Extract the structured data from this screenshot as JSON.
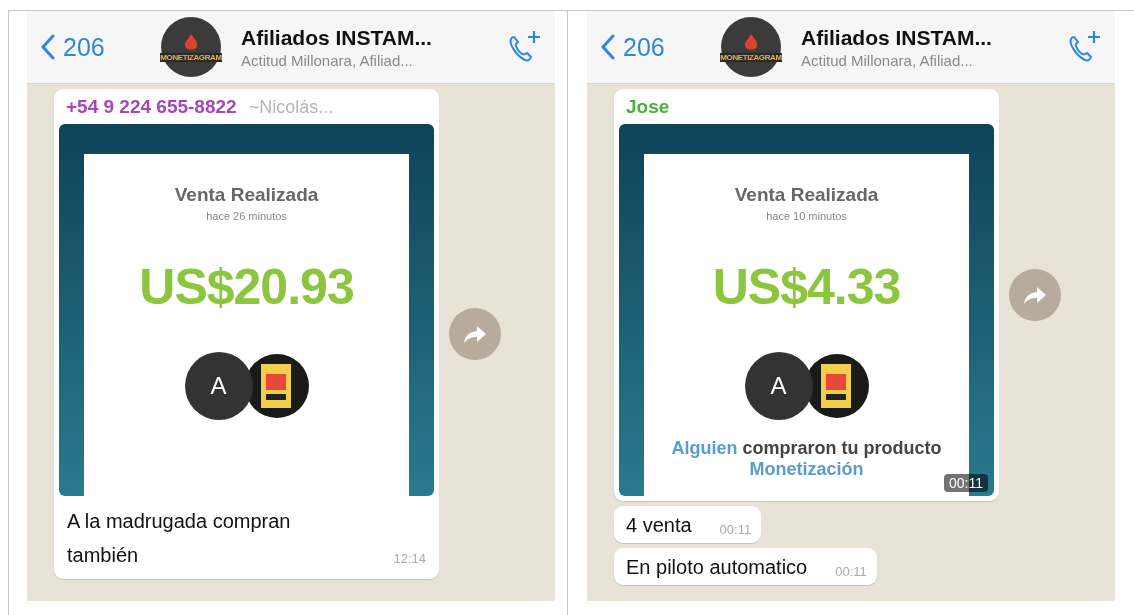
{
  "panels": [
    {
      "header": {
        "back_count": "206",
        "avatar_label": "MONETIZAGRAM",
        "title": "Afiliados INSTAM...",
        "subtitle": "Actitud Millonara, Afiliad..."
      },
      "messages": [
        {
          "kind": "image",
          "sender": "+54 9 224 655-8822",
          "sender_name": "~Nicolás...",
          "color": "#a447bd",
          "card": {
            "title": "Venta Realizada",
            "ago": "hace 26 minutos",
            "amount": "US$20.93",
            "avatar_letter": "A"
          },
          "caption": "A la madrugada compran también",
          "time": "12:14"
        }
      ]
    },
    {
      "header": {
        "back_count": "206",
        "avatar_label": "MONETIZAGRAM",
        "title": "Afiliados INSTAM...",
        "subtitle": "Actitud Millonara, Afiliad..."
      },
      "messages": [
        {
          "kind": "image",
          "sender": "Jose",
          "color": "#4caf3c",
          "card": {
            "title": "Venta Realizada",
            "ago": "hace 10 minutos",
            "amount": "US$4.33",
            "avatar_letter": "A",
            "footer": [
              {
                "text": "Alguien",
                "highlight": true
              },
              {
                "text": " compraron tu producto ",
                "highlight": false
              },
              {
                "text": "Monetización",
                "highlight": true
              }
            ]
          },
          "time": "00:11"
        },
        {
          "kind": "text",
          "text": "4 venta",
          "time": "00:11"
        },
        {
          "kind": "text",
          "text": "En piloto automatico",
          "time": "00:11"
        }
      ]
    }
  ]
}
